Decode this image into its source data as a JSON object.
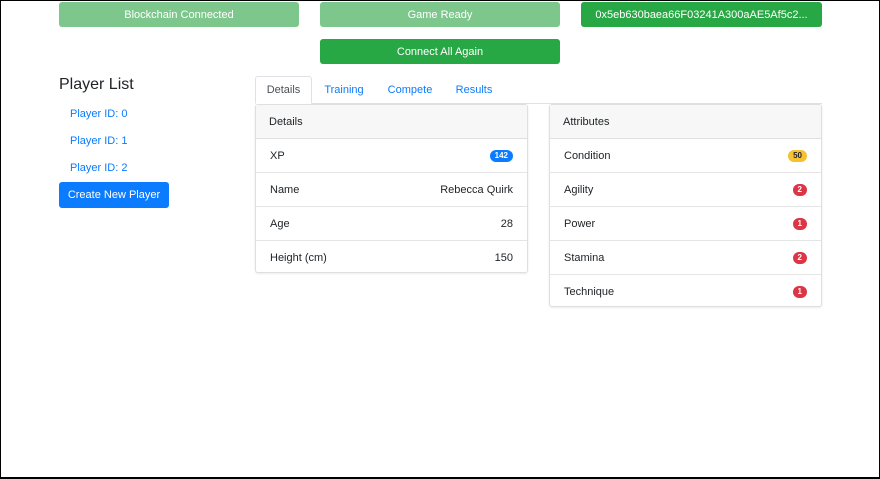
{
  "header": {
    "blockchain_label": "Blockchain Connected",
    "game_label": "Game Ready",
    "address_label": "0x5eb630baea66F03241A300aAE5Af5c2...",
    "connect_label": "Connect All Again"
  },
  "sidebar": {
    "title": "Player List",
    "players": [
      "Player ID: 0",
      "Player ID: 1",
      "Player ID: 2"
    ],
    "create_label": "Create New Player"
  },
  "tabs": [
    "Details",
    "Training",
    "Compete",
    "Results"
  ],
  "details_card": {
    "title": "Details",
    "xp_label": "XP",
    "xp_value": "142",
    "rows": [
      {
        "label": "Name",
        "value": "Rebecca Quirk"
      },
      {
        "label": "Age",
        "value": "28"
      },
      {
        "label": "Height (cm)",
        "value": "150"
      }
    ]
  },
  "attributes_card": {
    "title": "Attributes",
    "rows": [
      {
        "label": "Condition",
        "value": "50",
        "color": "#f5c133"
      },
      {
        "label": "Agility",
        "value": "2",
        "color": "#dc3545"
      },
      {
        "label": "Power",
        "value": "1",
        "color": "#dc3545"
      },
      {
        "label": "Stamina",
        "value": "2",
        "color": "#dc3545"
      },
      {
        "label": "Technique",
        "value": "1",
        "color": "#dc3545"
      }
    ]
  },
  "colors": {
    "primary": "#0b7bff",
    "success": "#28a745",
    "success_light": "#7dc78c",
    "danger": "#dc3545",
    "warning": "#f5c133"
  }
}
